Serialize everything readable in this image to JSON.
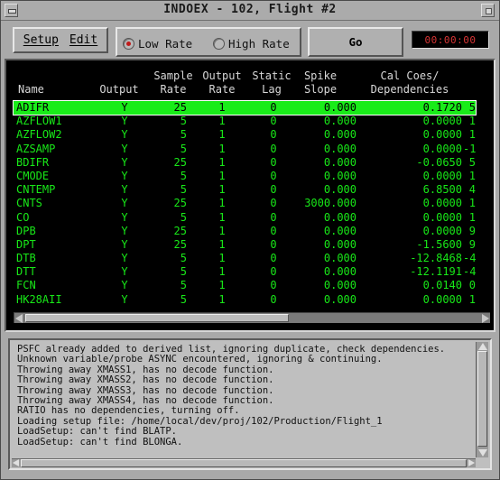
{
  "window": {
    "title": "INDOEX - 102, Flight #2"
  },
  "toolbar": {
    "setup_label": "Setup",
    "edit_label": "Edit",
    "low_rate_label": "Low Rate",
    "high_rate_label": "High Rate",
    "selected_rate": "Low Rate",
    "go_label": "Go",
    "timer_value": "00:00:00"
  },
  "table": {
    "headers": {
      "name": "Name",
      "output": "Output",
      "sample_rate": "Sample\nRate",
      "output_rate": "Output\nRate",
      "static_lag": "Static\nLag",
      "spike_slope": "Spike\nSlope",
      "cal_coes": "Cal Coes/\nDependencies"
    },
    "rows": [
      {
        "name": "ADIFR",
        "output": "Y",
        "sample_rate": "25",
        "output_rate": "1",
        "static_lag": "0",
        "spike_slope": "0.000",
        "cal": "0.1720",
        "dep": "5",
        "selected": true
      },
      {
        "name": "AZFLOW1",
        "output": "Y",
        "sample_rate": "5",
        "output_rate": "1",
        "static_lag": "0",
        "spike_slope": "0.000",
        "cal": "0.0000",
        "dep": "1"
      },
      {
        "name": "AZFLOW2",
        "output": "Y",
        "sample_rate": "5",
        "output_rate": "1",
        "static_lag": "0",
        "spike_slope": "0.000",
        "cal": "0.0000",
        "dep": "1"
      },
      {
        "name": "AZSAMP",
        "output": "Y",
        "sample_rate": "5",
        "output_rate": "1",
        "static_lag": "0",
        "spike_slope": "0.000",
        "cal": "0.0000",
        "dep": "-1"
      },
      {
        "name": "BDIFR",
        "output": "Y",
        "sample_rate": "25",
        "output_rate": "1",
        "static_lag": "0",
        "spike_slope": "0.000",
        "cal": "-0.0650",
        "dep": "5"
      },
      {
        "name": "CMODE",
        "output": "Y",
        "sample_rate": "5",
        "output_rate": "1",
        "static_lag": "0",
        "spike_slope": "0.000",
        "cal": "0.0000",
        "dep": "1"
      },
      {
        "name": "CNTEMP",
        "output": "Y",
        "sample_rate": "5",
        "output_rate": "1",
        "static_lag": "0",
        "spike_slope": "0.000",
        "cal": "6.8500",
        "dep": "4"
      },
      {
        "name": "CNTS",
        "output": "Y",
        "sample_rate": "25",
        "output_rate": "1",
        "static_lag": "0",
        "spike_slope": "3000.000",
        "cal": "0.0000",
        "dep": "1"
      },
      {
        "name": "CO",
        "output": "Y",
        "sample_rate": "5",
        "output_rate": "1",
        "static_lag": "0",
        "spike_slope": "0.000",
        "cal": "0.0000",
        "dep": "1"
      },
      {
        "name": "DPB",
        "output": "Y",
        "sample_rate": "25",
        "output_rate": "1",
        "static_lag": "0",
        "spike_slope": "0.000",
        "cal": "0.0000",
        "dep": "9"
      },
      {
        "name": "DPT",
        "output": "Y",
        "sample_rate": "25",
        "output_rate": "1",
        "static_lag": "0",
        "spike_slope": "0.000",
        "cal": "-1.5600",
        "dep": "9"
      },
      {
        "name": "DTB",
        "output": "Y",
        "sample_rate": "5",
        "output_rate": "1",
        "static_lag": "0",
        "spike_slope": "0.000",
        "cal": "-12.8468",
        "dep": "-4"
      },
      {
        "name": "DTT",
        "output": "Y",
        "sample_rate": "5",
        "output_rate": "1",
        "static_lag": "0",
        "spike_slope": "0.000",
        "cal": "-12.1191",
        "dep": "-4"
      },
      {
        "name": "FCN",
        "output": "Y",
        "sample_rate": "5",
        "output_rate": "1",
        "static_lag": "0",
        "spike_slope": "0.000",
        "cal": "0.0140",
        "dep": "0"
      },
      {
        "name": "HK28AII",
        "output": "Y",
        "sample_rate": "5",
        "output_rate": "1",
        "static_lag": "0",
        "spike_slope": "0.000",
        "cal": "0.0000",
        "dep": "1"
      }
    ]
  },
  "log": {
    "lines": [
      "PSFC already added to derived list, ignoring duplicate, check dependencies.",
      "Unknown variable/probe ASYNC encountered, ignoring & continuing.",
      "Throwing away XMASS1, has no decode function.",
      "Throwing away XMASS2, has no decode function.",
      "Throwing away XMASS3, has no decode function.",
      "Throwing away XMASS4, has no decode function.",
      "RATIO has no dependencies, turning off.",
      "Loading setup file: /home/local/dev/proj/102/Production/Flight_1",
      "LoadSetup: can't find BLATP.",
      "LoadSetup: can't find BLONGA."
    ]
  },
  "colors": {
    "table_bg": "#000000",
    "row_text": "#18e818",
    "selected_row_bg": "#19ec19",
    "timer_text": "#d83535",
    "radio_selected": "#c01a1a"
  }
}
